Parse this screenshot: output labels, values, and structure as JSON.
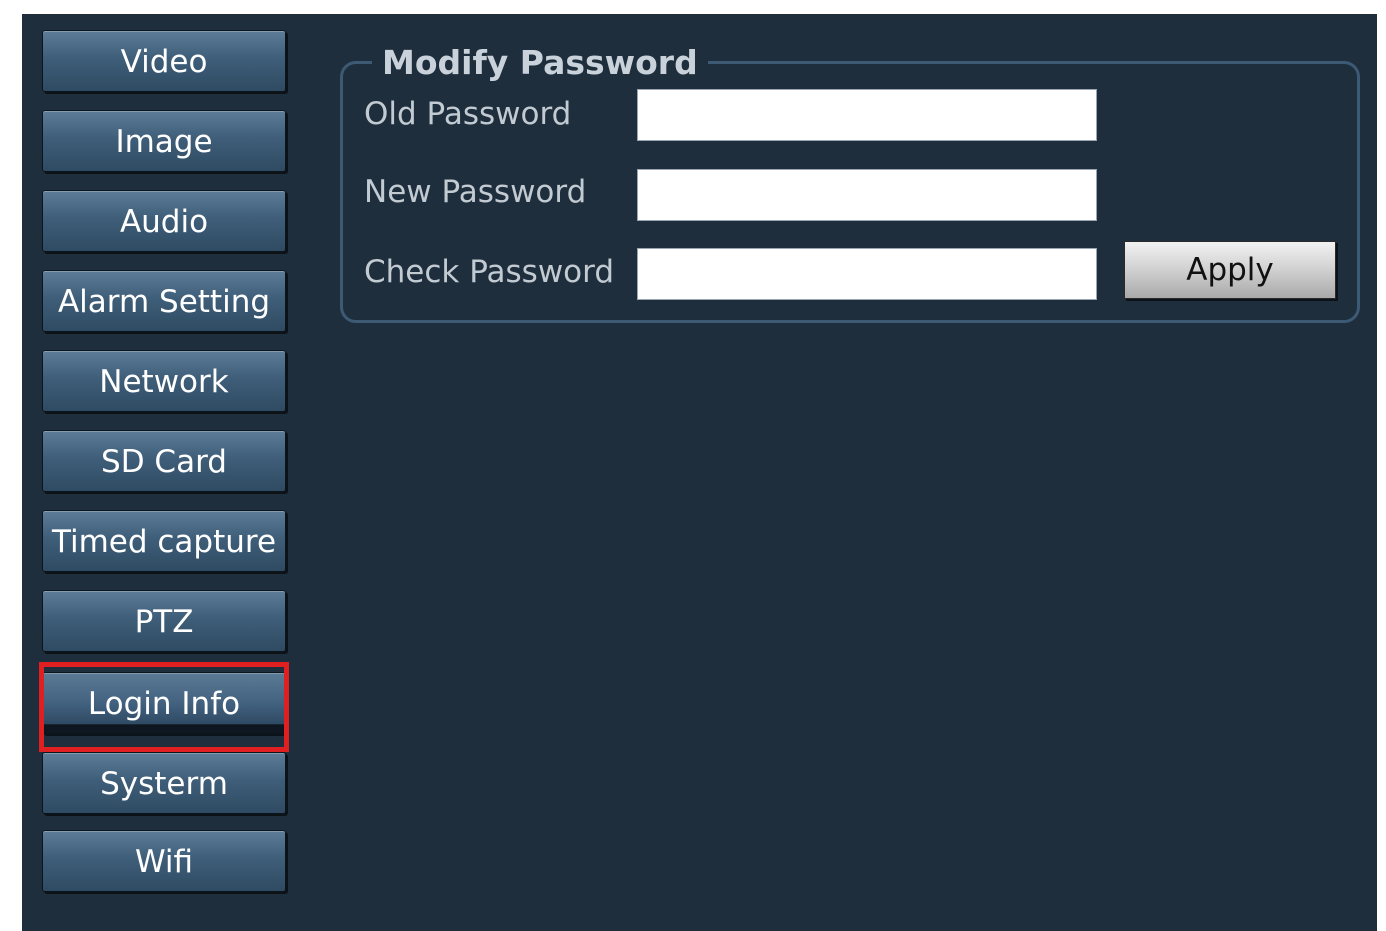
{
  "sidebar": {
    "items": [
      {
        "label": "Video"
      },
      {
        "label": "Image"
      },
      {
        "label": "Audio"
      },
      {
        "label": "Alarm Setting"
      },
      {
        "label": "Network"
      },
      {
        "label": "SD Card"
      },
      {
        "label": "Timed capture"
      },
      {
        "label": "PTZ"
      },
      {
        "label": "Login Info",
        "selected": true,
        "highlighted": true
      },
      {
        "label": "Systerm"
      },
      {
        "label": "Wifi"
      }
    ]
  },
  "modify_password": {
    "title": "Modify Password",
    "old_password": {
      "label": "Old Password",
      "value": ""
    },
    "new_password": {
      "label": "New Password",
      "value": ""
    },
    "check_password": {
      "label": "Check Password",
      "value": ""
    },
    "apply_label": "Apply"
  },
  "colors": {
    "background": "#1f2e3d",
    "button_top": "#5c7c97",
    "button_bottom": "#2f4b63",
    "highlight": "#e02020",
    "label_text": "#c2cad2"
  }
}
